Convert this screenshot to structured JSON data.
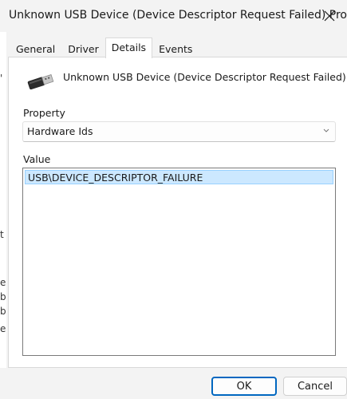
{
  "window": {
    "title": "Unknown USB Device (Device Descriptor Request Failed) Properties",
    "close_icon": "close-icon"
  },
  "tabs": [
    {
      "label": "General",
      "active": false
    },
    {
      "label": "Driver",
      "active": false
    },
    {
      "label": "Details",
      "active": true
    },
    {
      "label": "Events",
      "active": false
    }
  ],
  "details": {
    "device_name": "Unknown USB Device (Device Descriptor Request Failed)",
    "device_icon": "usb-connector-icon",
    "property_label": "Property",
    "property_selected": "Hardware Ids",
    "value_label": "Value",
    "values": [
      "USB\\DEVICE_DESCRIPTOR_FAILURE"
    ]
  },
  "buttons": {
    "ok": "OK",
    "cancel": "Cancel"
  },
  "background_fragments": [
    "'",
    "t",
    "e",
    "b",
    "b",
    "e"
  ],
  "colors": {
    "accent": "#0067c0",
    "selection": "#cce8ff",
    "selection_border": "#99d1ff"
  }
}
